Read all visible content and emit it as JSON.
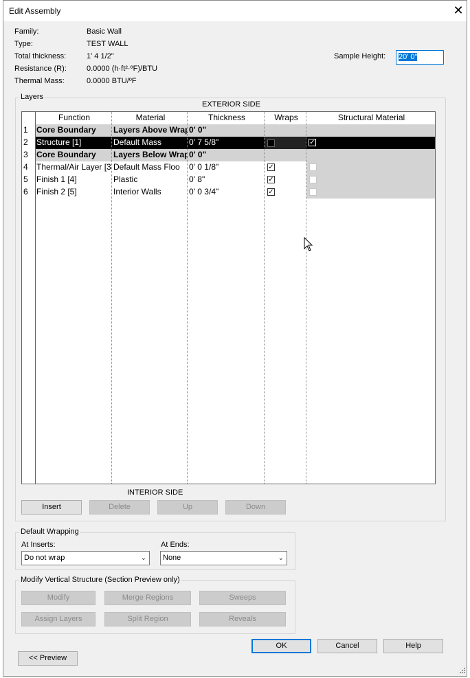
{
  "window": {
    "title": "Edit Assembly",
    "close_glyph": "✕"
  },
  "info": {
    "family_label": "Family:",
    "family": "Basic Wall",
    "type_label": "Type:",
    "type": "TEST WALL",
    "thickness_label": "Total thickness:",
    "thickness": "1'  4 1/2\"",
    "resistance_label": "Resistance (R):",
    "resistance": "0.0000 (h·ft²·ºF)/BTU",
    "mass_label": "Thermal Mass:",
    "mass": "0.0000 BTU/ºF"
  },
  "sample_height": {
    "label": "Sample Height:",
    "value": "20'  0\""
  },
  "layers": {
    "group_title": "Layers",
    "exterior_label": "EXTERIOR SIDE",
    "interior_label": "INTERIOR SIDE",
    "headers": {
      "function": "Function",
      "material": "Material",
      "thickness": "Thickness",
      "wraps": "Wraps",
      "structural": "Structural Material"
    },
    "rows": [
      {
        "num": "1",
        "function": "Core Boundary",
        "material": "Layers Above Wrap",
        "thickness": "0'  0\""
      },
      {
        "num": "2",
        "function": "Structure [1]",
        "material": "Default Mass",
        "thickness": "0'  7 5/8\""
      },
      {
        "num": "3",
        "function": "Core Boundary",
        "material": "Layers Below Wrap",
        "thickness": "0'  0\""
      },
      {
        "num": "4",
        "function": "Thermal/Air Layer [3",
        "material": "Default Mass Floo",
        "thickness": "0'  0 1/8\""
      },
      {
        "num": "5",
        "function": "Finish 1 [4]",
        "material": "Plastic",
        "thickness": "0'  8\""
      },
      {
        "num": "6",
        "function": "Finish 2 [5]",
        "material": "Interior Walls",
        "thickness": "0'  0 3/4\""
      }
    ],
    "buttons": {
      "insert": "Insert",
      "delete": "Delete",
      "up": "Up",
      "down": "Down"
    }
  },
  "wrapping": {
    "group_title": "Default Wrapping",
    "inserts_label": "At Inserts:",
    "inserts_value": "Do not wrap",
    "ends_label": "At Ends:",
    "ends_value": "None"
  },
  "vertical": {
    "group_title": "Modify Vertical Structure (Section Preview only)",
    "modify": "Modify",
    "merge": "Merge Regions",
    "sweeps": "Sweeps",
    "assign": "Assign Layers",
    "split": "Split Region",
    "reveals": "Reveals"
  },
  "footer": {
    "ok": "OK",
    "cancel": "Cancel",
    "help": "Help",
    "preview": "<< Preview"
  },
  "colors": {
    "accent": "#0078d7",
    "selected_row": "#000000",
    "core_row": "#d3d3d3"
  }
}
